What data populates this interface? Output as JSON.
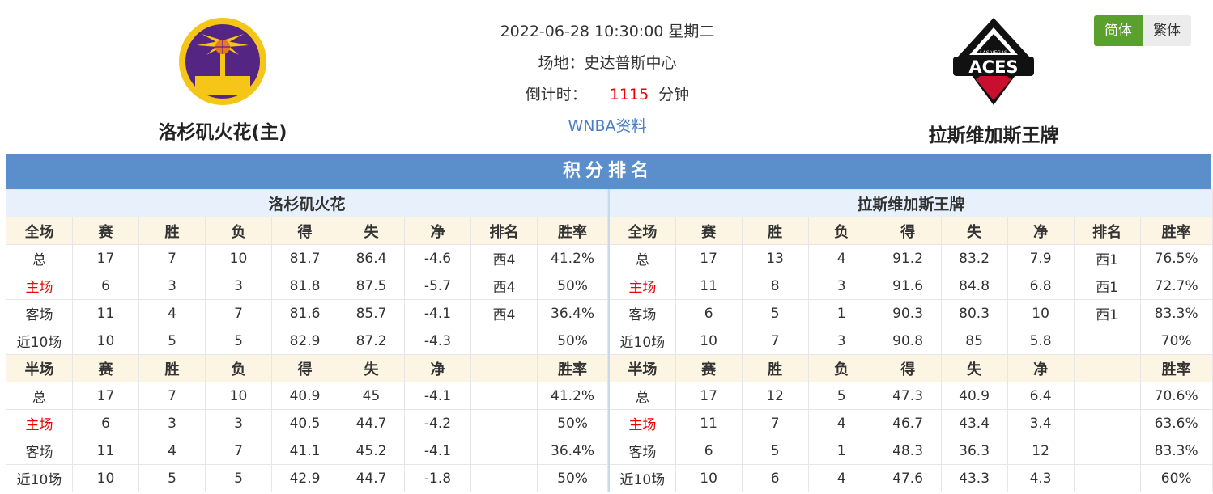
{
  "match": {
    "datetime": "2022-06-28 10:30:00 星期二",
    "venue_label": "场地：",
    "venue": "史达普斯中心",
    "countdown_label": "倒计时：",
    "countdown_value": "1115",
    "countdown_unit": "分钟",
    "link": "WNBA资料"
  },
  "home_team": {
    "name": "洛杉矶火花(主)",
    "short_name": "洛杉矶火花",
    "logo_icon": "la-sparks-logo"
  },
  "away_team": {
    "name": "拉斯维加斯王牌",
    "short_name": "拉斯维加斯王牌",
    "logo_icon": "las-vegas-aces-logo",
    "logo_text": "ACES",
    "logo_small_text": "LAS VEGAS"
  },
  "lang": {
    "simplified": "简体",
    "traditional": "繁体"
  },
  "section_title": "积分排名",
  "colors": {
    "accent": "#5b8fcb",
    "active_lang": "#5aa02c",
    "highlight_red": "#e00000",
    "header_bg": "#fcf5e4",
    "team_row_bg": "#e8f1fb"
  },
  "home": {
    "full_header": [
      "全场",
      "赛",
      "胜",
      "负",
      "得",
      "失",
      "净",
      "排名",
      "胜率"
    ],
    "full_rows": [
      [
        "总",
        "17",
        "7",
        "10",
        "81.7",
        "86.4",
        "-4.6",
        "西4",
        "41.2%"
      ],
      [
        "主场",
        "6",
        "3",
        "3",
        "81.8",
        "87.5",
        "-5.7",
        "西4",
        "50%"
      ],
      [
        "客场",
        "11",
        "4",
        "7",
        "81.6",
        "85.7",
        "-4.1",
        "西4",
        "36.4%"
      ],
      [
        "近10场",
        "10",
        "5",
        "5",
        "82.9",
        "87.2",
        "-4.3",
        "",
        "50%"
      ]
    ],
    "half_header": [
      "半场",
      "赛",
      "胜",
      "负",
      "得",
      "失",
      "净",
      "",
      "胜率"
    ],
    "half_rows": [
      [
        "总",
        "17",
        "7",
        "10",
        "40.9",
        "45",
        "-4.1",
        "",
        "41.2%"
      ],
      [
        "主场",
        "6",
        "3",
        "3",
        "40.5",
        "44.7",
        "-4.2",
        "",
        "50%"
      ],
      [
        "客场",
        "11",
        "4",
        "7",
        "41.1",
        "45.2",
        "-4.1",
        "",
        "36.4%"
      ],
      [
        "近10场",
        "10",
        "5",
        "5",
        "42.9",
        "44.7",
        "-1.8",
        "",
        "50%"
      ]
    ]
  },
  "away": {
    "full_header": [
      "全场",
      "赛",
      "胜",
      "负",
      "得",
      "失",
      "净",
      "排名",
      "胜率"
    ],
    "full_rows": [
      [
        "总",
        "17",
        "13",
        "4",
        "91.2",
        "83.2",
        "7.9",
        "西1",
        "76.5%"
      ],
      [
        "主场",
        "11",
        "8",
        "3",
        "91.6",
        "84.8",
        "6.8",
        "西1",
        "72.7%"
      ],
      [
        "客场",
        "6",
        "5",
        "1",
        "90.3",
        "80.3",
        "10",
        "西1",
        "83.3%"
      ],
      [
        "近10场",
        "10",
        "7",
        "3",
        "90.8",
        "85",
        "5.8",
        "",
        "70%"
      ]
    ],
    "half_header": [
      "半场",
      "赛",
      "胜",
      "负",
      "得",
      "失",
      "净",
      "",
      "胜率"
    ],
    "half_rows": [
      [
        "总",
        "17",
        "12",
        "5",
        "47.3",
        "40.9",
        "6.4",
        "",
        "70.6%"
      ],
      [
        "主场",
        "11",
        "7",
        "4",
        "46.7",
        "43.4",
        "3.4",
        "",
        "63.6%"
      ],
      [
        "客场",
        "6",
        "5",
        "1",
        "48.3",
        "36.3",
        "12",
        "",
        "83.3%"
      ],
      [
        "近10场",
        "10",
        "6",
        "4",
        "47.6",
        "43.3",
        "4.3",
        "",
        "60%"
      ]
    ]
  }
}
